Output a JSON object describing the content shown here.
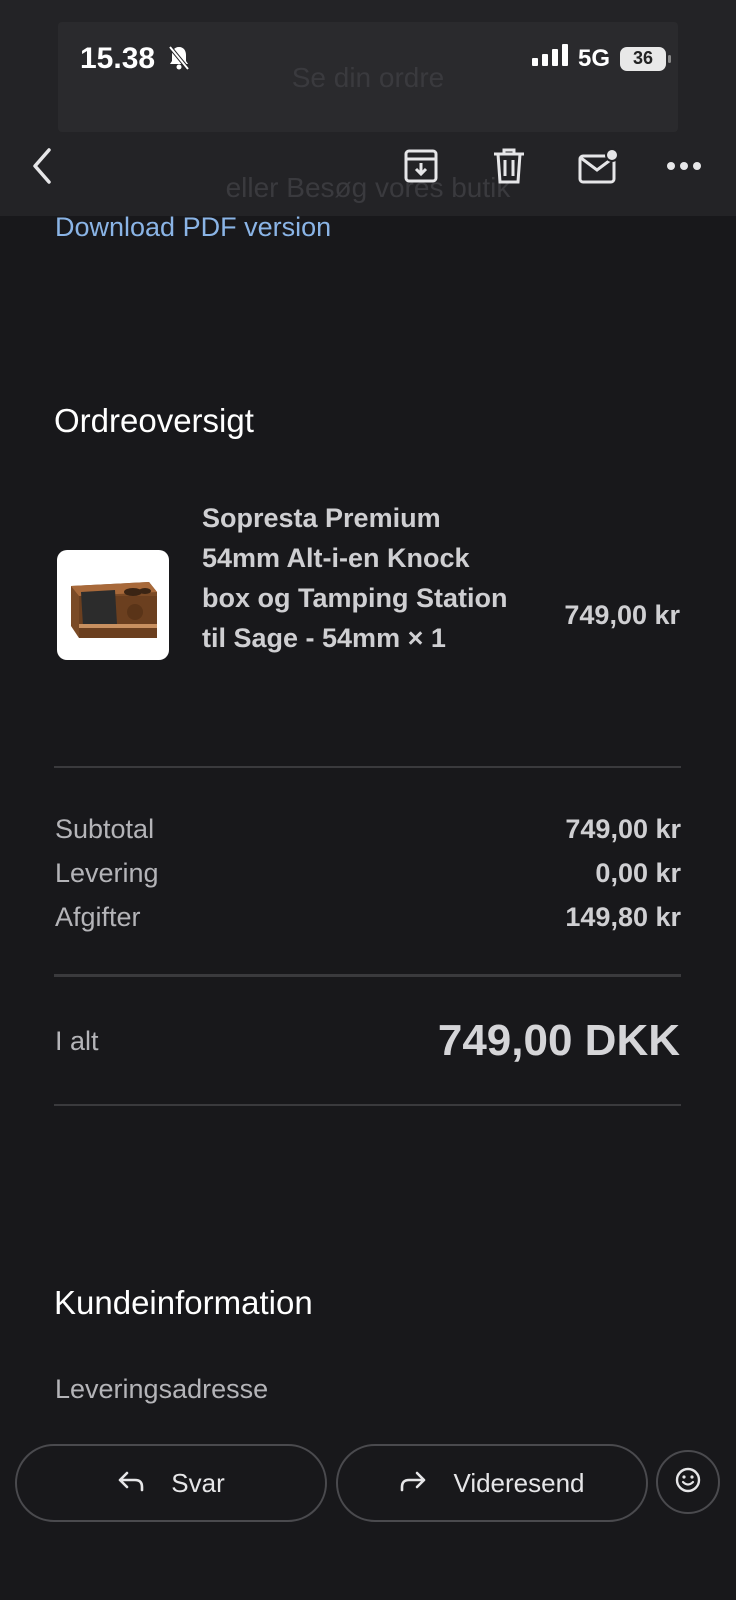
{
  "status": {
    "time": "15.38",
    "network": "5G",
    "battery": "36"
  },
  "overlay": {
    "ghost_button": "Se din ordre",
    "ghost_text": "eller Besøg vores butik"
  },
  "toolbar": {
    "back": "back",
    "archive": "archive",
    "delete": "delete",
    "mark_unread": "mark-unread",
    "more": "more"
  },
  "email": {
    "download_pdf": "Download PDF version",
    "order_title": "Ordreoversigt",
    "product": {
      "name": "Sopresta Premium 54mm Alt-i-en Knock box og Tamping Station til Sage - 54mm × 1",
      "price": "749,00 kr"
    },
    "summary": [
      {
        "label": "Subtotal",
        "value": "749,00 kr"
      },
      {
        "label": "Levering",
        "value": "0,00 kr"
      },
      {
        "label": "Afgifter",
        "value": "149,80 kr"
      }
    ],
    "total": {
      "label": "I alt",
      "value": "749,00 DKK"
    },
    "customer_title": "Kundeinformation",
    "shipping_heading": "Leveringsadresse"
  },
  "actions": {
    "reply": "Svar",
    "forward": "Videresend"
  },
  "colors": {
    "background": "#18181b",
    "topbar": "#232326",
    "link": "#8ab4e6"
  }
}
